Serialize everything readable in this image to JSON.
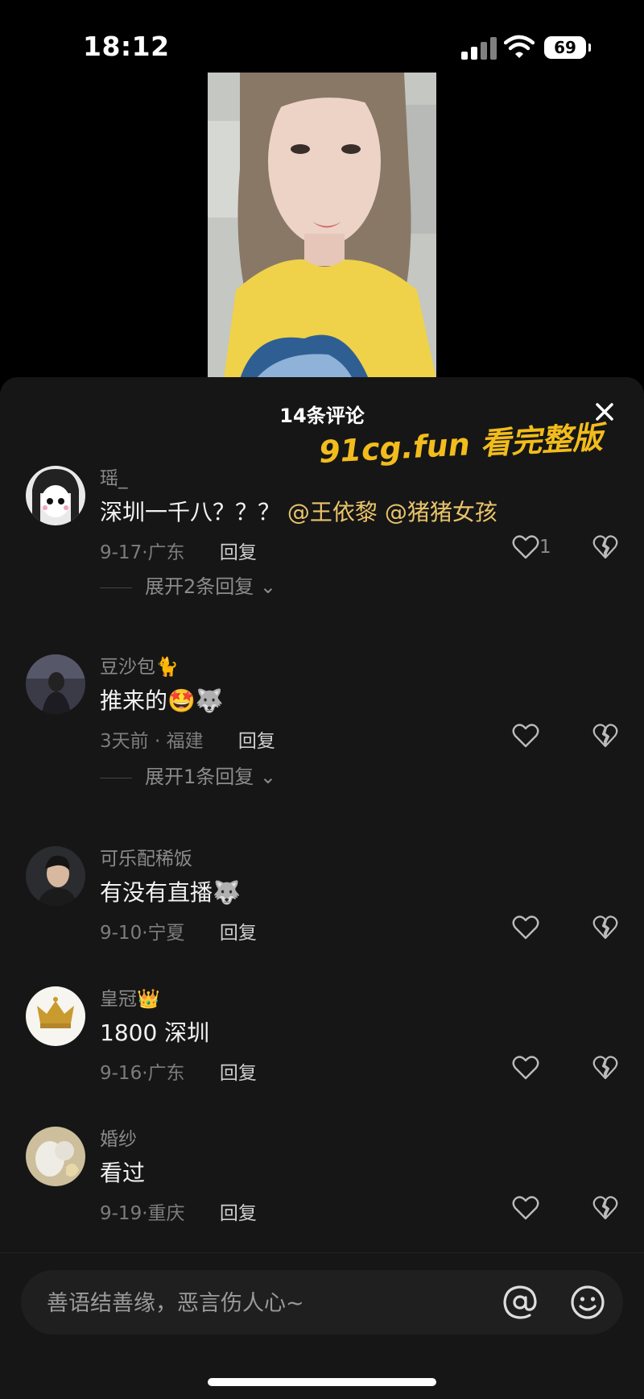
{
  "status_bar": {
    "time": "18:12",
    "battery": "69"
  },
  "sheet": {
    "title": "14条评论",
    "promo": "91cg.fun 看完整版"
  },
  "comments": [
    {
      "username": "瑶_",
      "text": "深圳一千八？？？",
      "mentions": "@王依黎 @猪猪女孩",
      "date": "9-17",
      "location": "广东",
      "reply_label": "回复",
      "likes": "1",
      "expand": "展开2条回复"
    },
    {
      "username": "豆沙包🐈",
      "text": "推来的🤩🐺",
      "date": "3天前",
      "location": "福建",
      "reply_label": "回复",
      "expand": "展开1条回复"
    },
    {
      "username": "可乐配稀饭",
      "text": "有没有直播🐺",
      "date": "9-10",
      "location": "宁夏",
      "reply_label": "回复"
    },
    {
      "username": "皇冠👑",
      "text": "1800 深圳",
      "date": "9-16",
      "location": "广东",
      "reply_label": "回复"
    },
    {
      "username": "婚纱",
      "text": "看过",
      "date": "9-19",
      "location": "重庆",
      "reply_label": "回复"
    }
  ],
  "input_bar": {
    "placeholder": "善语结善缘，恶言伤人心~"
  },
  "icons": {
    "close": "close-icon",
    "like": "heart-outline-icon",
    "dislike": "broken-heart-icon",
    "mention": "at-icon",
    "emoji": "smiley-icon"
  },
  "colors": {
    "accent": "#f2bc1c",
    "mention": "#e9c46a",
    "sheet_bg": "#161616"
  }
}
